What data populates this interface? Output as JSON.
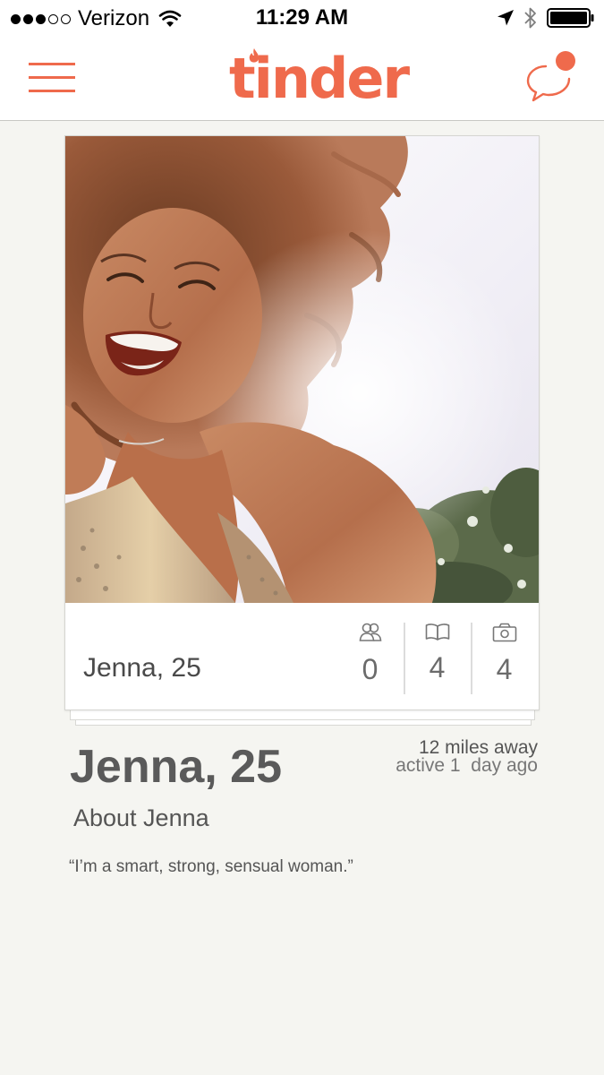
{
  "status_bar": {
    "carrier": "Verizon",
    "time": "11:29 AM",
    "signal_bars_filled": 3,
    "signal_bars_total": 5,
    "icons": [
      "wifi-icon",
      "location-arrow-icon",
      "bluetooth-icon",
      "battery-icon"
    ]
  },
  "header": {
    "logo_text": "tinder",
    "menu_icon": "hamburger-menu-icon",
    "chat_icon": "chat-bubble-icon",
    "chat_has_notification": true
  },
  "card": {
    "name_age": "Jenna, 25",
    "stats": [
      {
        "icon": "shared-friends-icon",
        "count": "0"
      },
      {
        "icon": "shared-interests-icon",
        "count": "4"
      },
      {
        "icon": "photos-icon",
        "count": "4"
      }
    ]
  },
  "profile": {
    "name_age": "Jenna, 25",
    "distance": "12 miles away",
    "last_active": "active 1  day ago",
    "about_heading": "About Jenna",
    "bio": "“I’m a smart, strong, sensual woman.”"
  },
  "colors": {
    "brand": "#ef6a4c",
    "background": "#f5f5f1",
    "text": "#555555"
  }
}
